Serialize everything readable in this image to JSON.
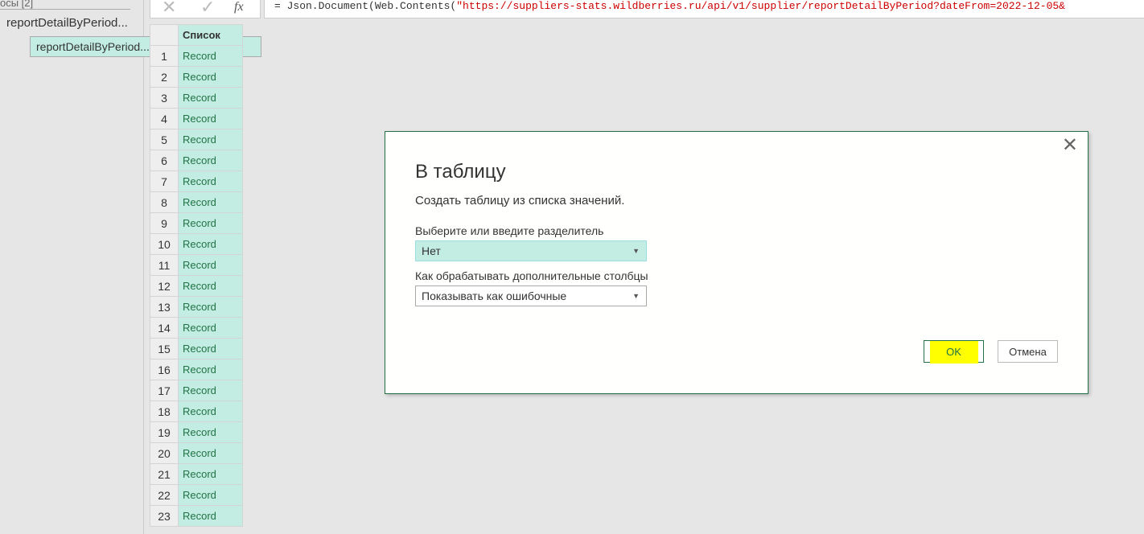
{
  "sidebar": {
    "header": "осы [2]",
    "queries": [
      "reportDetailByPeriod...",
      "reportDetailByPeriod..."
    ]
  },
  "formula_bar": {
    "cancel_icon": "✕",
    "confirm_icon": "✓",
    "fx": "fx",
    "prefix": "= Json.Document(Web.Contents(",
    "url": "\"https://suppliers-stats.wildberries.ru/api/v1/supplier/reportDetailByPeriod?dateFrom=2022-12-05&"
  },
  "grid": {
    "column": "Список",
    "rows": [
      "1",
      "2",
      "3",
      "4",
      "5",
      "6",
      "7",
      "8",
      "9",
      "10",
      "11",
      "12",
      "13",
      "14",
      "15",
      "16",
      "17",
      "18",
      "19",
      "20",
      "21",
      "22",
      "23"
    ],
    "value": "Record"
  },
  "dialog": {
    "title": "В таблицу",
    "subtitle": "Создать таблицу из списка значений.",
    "delimiter_label": "Выберите или введите разделитель",
    "delimiter_value": "Нет",
    "extra_label": "Как обрабатывать дополнительные столбцы",
    "extra_value": "Показывать как ошибочные",
    "ok": "OK",
    "cancel": "Отмена",
    "close": "✕"
  },
  "colors": {
    "accent": "#217346",
    "selected": "#c3ede2",
    "highlight": "#ffff00"
  }
}
